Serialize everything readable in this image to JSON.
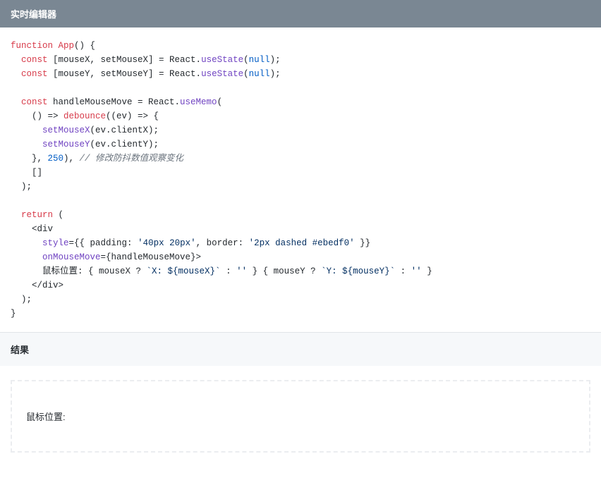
{
  "editor": {
    "title": "实时编辑器",
    "code": {
      "line1_kw": "function",
      "line1_name": " App",
      "line1_rest": "() {",
      "line2_const": "  const",
      "line2_rest1": " [mouseX, setMouseX] = React.",
      "line2_method": "useState",
      "line2_rest2": "(",
      "line2_null": "null",
      "line2_rest3": ");",
      "line3_const": "  const",
      "line3_rest1": " [mouseY, setMouseY] = React.",
      "line3_method": "useState",
      "line3_rest2": "(",
      "line3_null": "null",
      "line3_rest3": ");",
      "line5_const": "  const",
      "line5_rest1": " handleMouseMove = React.",
      "line5_method": "useMemo",
      "line5_rest2": "(",
      "line6_rest1": "    () => ",
      "line6_debounce": "debounce",
      "line6_rest2": "((ev) => {",
      "line7_call": "      setMouseX",
      "line7_rest": "(ev.clientX);",
      "line8_call": "      setMouseY",
      "line8_rest": "(ev.clientY);",
      "line9_brace": "    }, ",
      "line9_num": "250",
      "line9_rest": "), ",
      "line9_comment": "// 修改防抖数值观察变化",
      "line10": "    []",
      "line11": "  );",
      "line13_kw": "  return",
      "line13_rest": " (",
      "line14": "    <div",
      "line15_pre": "      ",
      "line15_attr": "style",
      "line15_rest1": "={{ padding: ",
      "line15_str1": "'40px 20px'",
      "line15_rest2": ", border: ",
      "line15_str2": "'2px dashed #ebedf0'",
      "line15_rest3": " }}",
      "line16_pre": "      ",
      "line16_attr": "onMouseMove",
      "line16_rest": "={handleMouseMove}>",
      "line17_pre": "      鼠标位置: { mouseX ? ",
      "line17_tpl1": "`X: ${mouseX}`",
      "line17_mid": " : ",
      "line17_str1": "''",
      "line17_mid2": " } { mouseY ? ",
      "line17_tpl2": "`Y: ${mouseY}`",
      "line17_mid3": " : ",
      "line17_str2": "''",
      "line17_end": " }",
      "line18": "    </div>",
      "line19": "  );",
      "line20": "}"
    }
  },
  "result": {
    "title": "结果",
    "output": "鼠标位置:"
  }
}
